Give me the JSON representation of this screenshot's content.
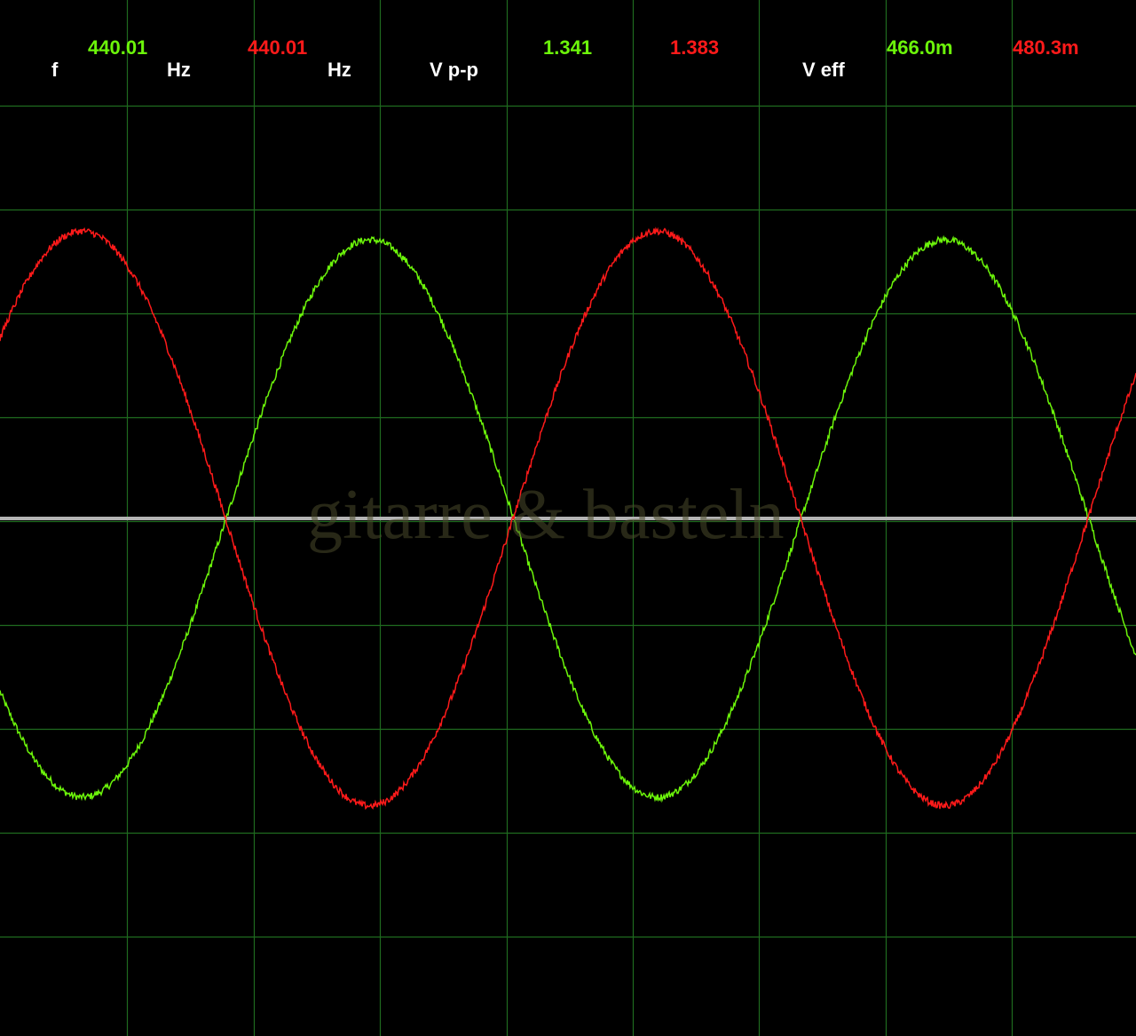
{
  "readouts": {
    "freq_label": "f",
    "ch1_freq": "440.01",
    "freq_unit_1": "Hz",
    "ch2_freq": "440.01",
    "freq_unit_2": "Hz",
    "vpp_label": "V p-p",
    "ch1_vpp": "1.341",
    "ch2_vpp": "1.383",
    "veff_label": "V eff",
    "ch1_veff": "466.0m",
    "ch2_veff": "480.3m"
  },
  "watermark": "gitarre & basteln",
  "colors": {
    "background": "#000000",
    "grid": "#1f6b1f",
    "baseline": "#b4b4b4",
    "channel_1": "#6cf50a",
    "channel_2": "#ff1a1a",
    "label": "#ffffff"
  },
  "chart_data": {
    "type": "line",
    "grid": true,
    "baseline": true,
    "x_divisions": 9,
    "y_divisions": 10,
    "ylim": [
      -1,
      1
    ],
    "series": [
      {
        "channel": "ch1",
        "color": "#6cf50a",
        "frequency_hz": 440.01,
        "vpp": 1.341,
        "veff": 0.466,
        "amplitude": 0.805,
        "zero_crossing_rising_div": 1.79,
        "period_div": 4.55,
        "noise": 0.01
      },
      {
        "channel": "ch2",
        "color": "#ff1a1a",
        "frequency_hz": 440.01,
        "vpp": 1.383,
        "veff": 0.4803,
        "amplitude": 0.83,
        "zero_crossing_rising_div": 4.06,
        "period_div": 4.55,
        "noise": 0.01
      }
    ]
  }
}
